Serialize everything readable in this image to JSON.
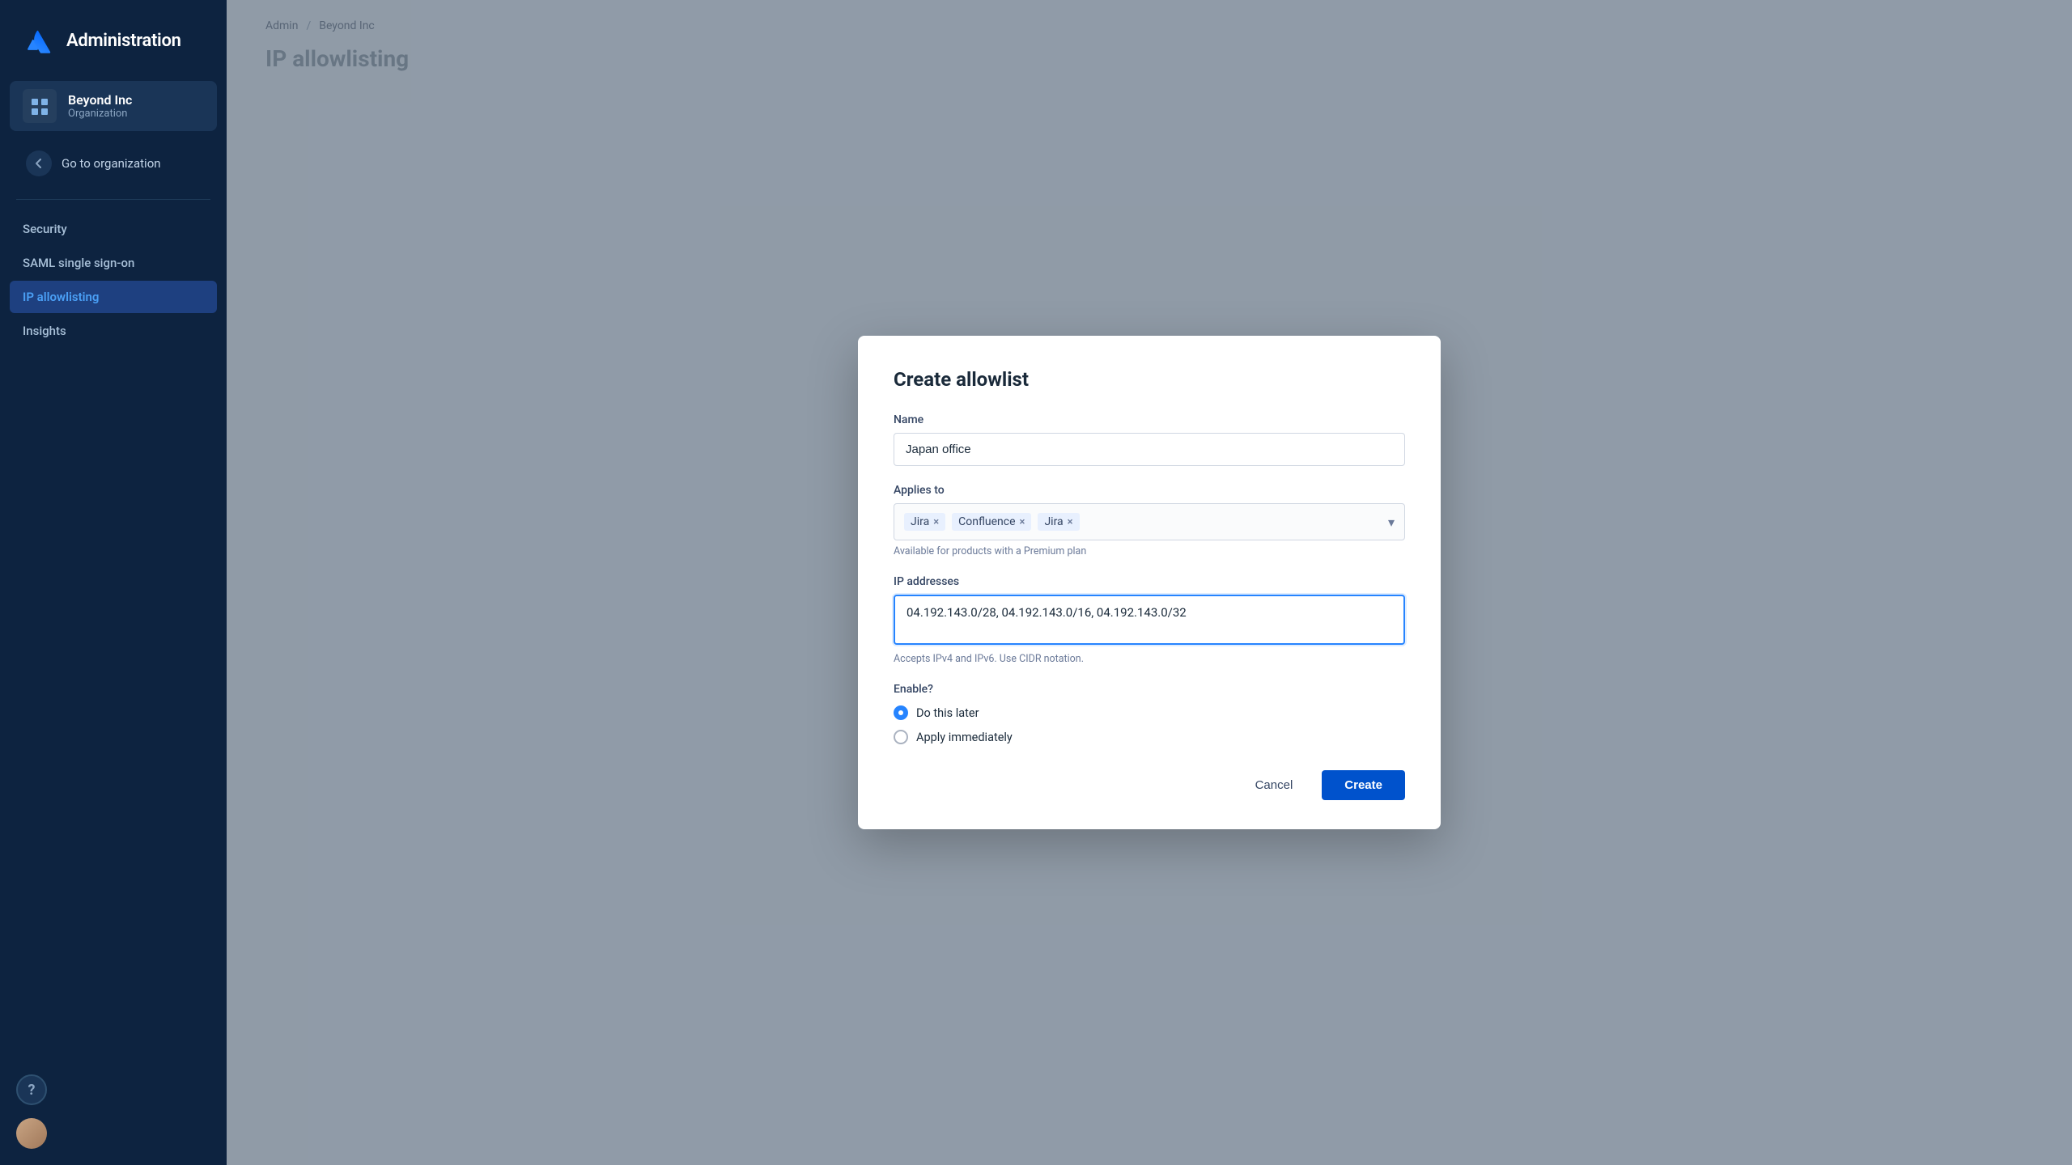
{
  "sidebar": {
    "logo_text": "Administration",
    "org": {
      "name": "Beyond Inc",
      "type": "Organization"
    },
    "back_label": "Go to organization",
    "nav_items": [
      {
        "id": "security",
        "label": "Security",
        "active": false
      },
      {
        "id": "saml",
        "label": "SAML single sign-on",
        "active": false
      },
      {
        "id": "ip-allowlisting",
        "label": "IP allowlisting",
        "active": true
      },
      {
        "id": "insights",
        "label": "Insights",
        "active": false
      }
    ]
  },
  "breadcrumb": {
    "items": [
      "Admin",
      "Beyond Inc"
    ]
  },
  "page": {
    "title": "IP allowlisting"
  },
  "modal": {
    "title": "Create allowlist",
    "name_label": "Name",
    "name_value": "Japan office",
    "applies_to_label": "Applies to",
    "tags": [
      {
        "id": "jira1",
        "label": "Jira"
      },
      {
        "id": "confluence",
        "label": "Confluence"
      },
      {
        "id": "jira2",
        "label": "Jira"
      }
    ],
    "premium_note": "Available for products with a Premium plan",
    "ip_label": "IP addresses",
    "ip_value": "04.192.143.0/28, 04.192.143.0/16, 04.192.143.0/32",
    "ip_hint": "Accepts IPv4 and IPv6. Use CIDR notation.",
    "enable_label": "Enable?",
    "radio_options": [
      {
        "id": "later",
        "label": "Do this later",
        "checked": true
      },
      {
        "id": "immediately",
        "label": "Apply immediately",
        "checked": false
      }
    ],
    "cancel_label": "Cancel",
    "create_label": "Create"
  }
}
